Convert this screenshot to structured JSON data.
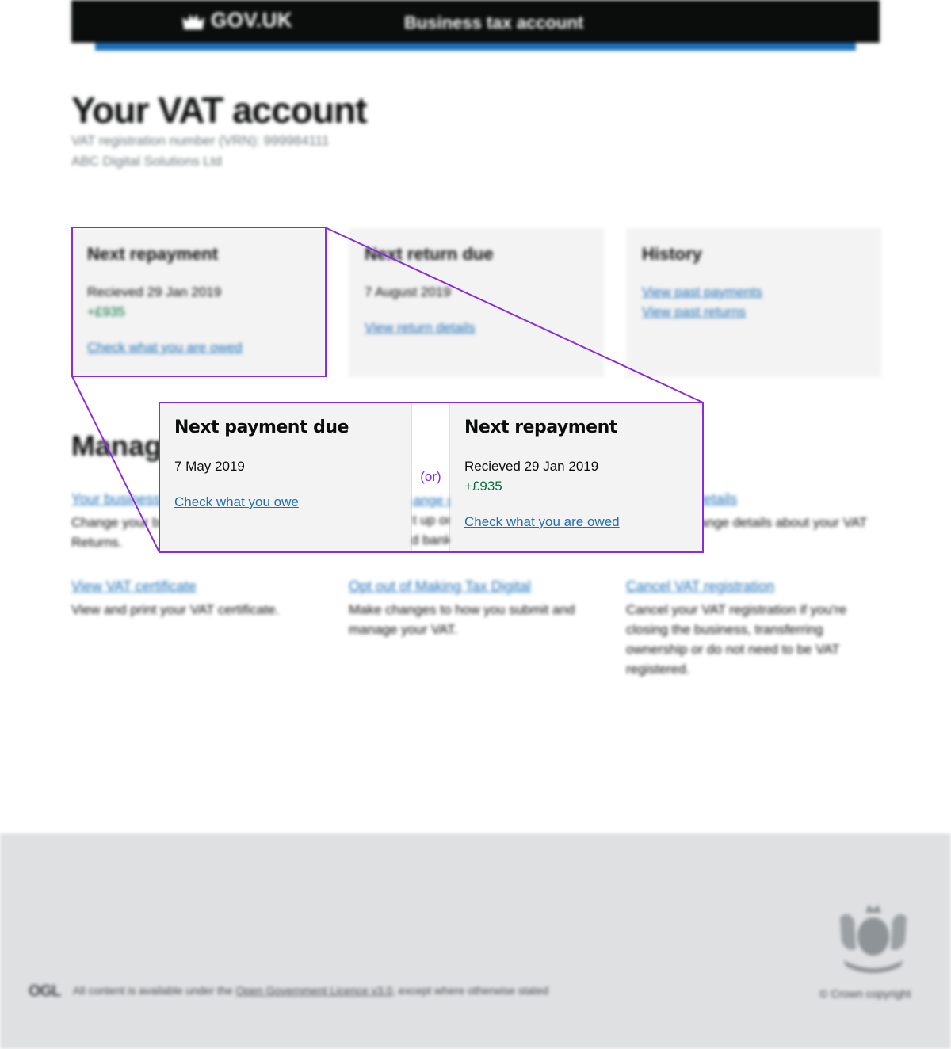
{
  "header": {
    "logo_text": "GOV.UK",
    "service_name": "Business tax account"
  },
  "page": {
    "title": "Your VAT account",
    "vrn_line": "VAT registration number (VRN): 999984111",
    "business_name": "ABC Digital Solutions Ltd"
  },
  "cards": [
    {
      "title": "Next repayment",
      "line1": "Recieved 29 Jan 2019",
      "amount": "+£935",
      "link": "Check what you are owed"
    },
    {
      "title": "Next return due",
      "line1": "7 August 2019",
      "link": "View return details"
    },
    {
      "title": "History",
      "links": [
        "View past payments",
        "View past returns"
      ]
    }
  ],
  "manage": {
    "title": "Manage your VAT",
    "items": [
      {
        "link": "Your business details",
        "desc": "Change your business details for VAT Returns."
      },
      {
        "link": "Change payment details",
        "desc": "Set up or change your direct debit and bank account for repayments."
      },
      {
        "link": "VAT group details",
        "desc": "View and change details about your VAT group."
      },
      {
        "link": "View VAT certificate",
        "desc": "View and print your VAT certificate."
      },
      {
        "link": "Opt out of Making Tax Digital",
        "desc": "Make changes to how you submit and manage your VAT."
      },
      {
        "link": "Cancel VAT registration",
        "desc": "Cancel your VAT registration if you're closing the business, transferring ownership or do not need to be VAT registered."
      }
    ]
  },
  "callout": {
    "left": {
      "title": "Next payment due",
      "line1": "7 May 2019",
      "link": "Check what you owe"
    },
    "separator": "(or)",
    "right": {
      "title": "Next repayment",
      "line1": "Recieved 29 Jan 2019",
      "amount": "+£935",
      "link": "Check what you are owed"
    },
    "mid_ghost_link": "Change payment details",
    "mid_ghost_desc1": "Set up or change direct debit",
    "mid_ghost_desc2": "and bank account for"
  },
  "footer": {
    "ogl": "OGL",
    "licence_prefix": "All content is available under the ",
    "licence_link": "Open Government Licence v3.0",
    "licence_suffix": ", except where otherwise stated",
    "copyright": "© Crown copyright"
  },
  "colors": {
    "header_bg": "#0b0c0c",
    "accent_blue": "#1d70b8",
    "callout_purple": "#8a2be2",
    "amount_green": "#00703c",
    "footer_bg": "#dee0e2"
  }
}
